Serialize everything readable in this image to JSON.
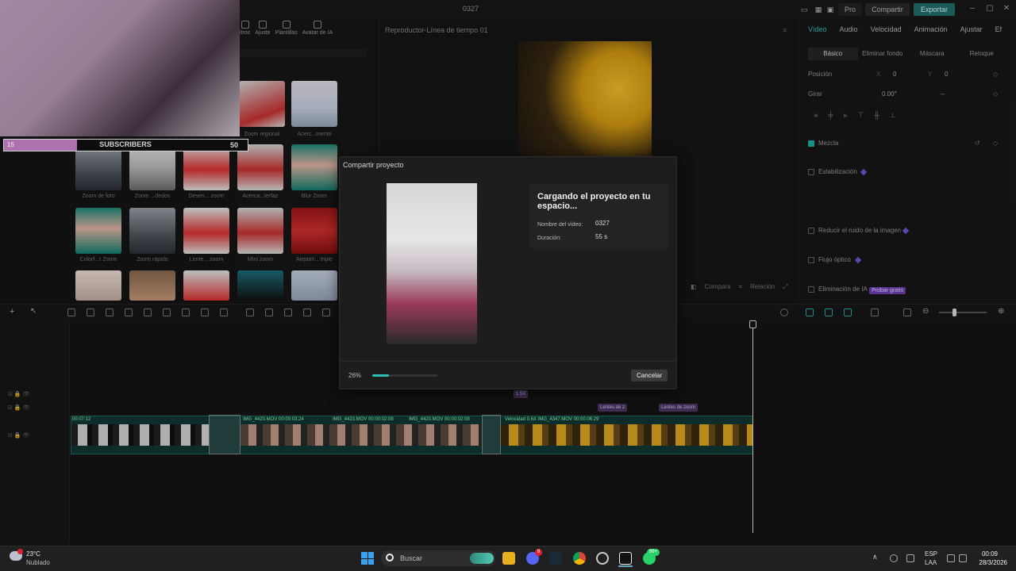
{
  "window": {
    "title": "0327",
    "pro_label": "Pro",
    "share_label": "Compartir",
    "export_label": "Exportar"
  },
  "media_tabs": [
    "itros",
    "Ajuste",
    "Plantillas",
    "Avatar de IA"
  ],
  "thumbnails": [
    {
      "label": "Zoom regional"
    },
    {
      "label": "Acerc...mente"
    },
    {
      "label": "Zoom de foto"
    },
    {
      "label": "Zoom ...dedos"
    },
    {
      "label": "Desen... zoom"
    },
    {
      "label": "Acerca...terfaz"
    },
    {
      "label": "Blur Zoom"
    },
    {
      "label": "Colorf...r Zoom"
    },
    {
      "label": "Zoom rápido"
    },
    {
      "label": "Lente... zoom"
    },
    {
      "label": "Mini zoom"
    },
    {
      "label": "Alejami... triple"
    }
  ],
  "overlay": {
    "left_count": "15",
    "label": "SUBSCRIBERS",
    "right_count": "50"
  },
  "player": {
    "title": "Reproductor-Línea de tiempo 01",
    "compare_label": "Compara",
    "ratio_label": "Relación"
  },
  "properties": {
    "tabs": [
      "Vídeo",
      "Audio",
      "Velocidad",
      "Animación",
      "Ajustar",
      "Ef"
    ],
    "subtabs": [
      "Básico",
      "Eliminar fondo",
      "Máscara",
      "Retoque"
    ],
    "position_label": "Posición",
    "x_label": "X",
    "x_value": "0",
    "y_label": "Y",
    "y_value": "0",
    "rotate_label": "Girar",
    "rotate_value": "0.00°",
    "rotate_dash": "–",
    "blend_label": "Mezcla",
    "stabilization_label": "Estabilización",
    "reduce_noise_label": "Reducir el ruido de la imagen",
    "optical_flow_label": "Flujo óptico",
    "ai_remove_label": "Eliminación de IA",
    "ai_badge": "Probar gratis"
  },
  "timeline": {
    "clip_labels": [
      "00:07:12",
      "IMG_4420.MOV  00:00:03:24",
      "IMG_4423.MOV  00:00:02:08",
      "IMG_4420.MOV  00:00:02:08",
      "Velocidad 0.6X   IMG_4347.MOV  00:00:06:29"
    ],
    "tags": [
      "Lentes de z",
      "Lentes de zoom"
    ],
    "speed_mark": "1.5X"
  },
  "modal": {
    "title": "Compartir proyecto",
    "heading": "Cargando el proyecto en tu espacio...",
    "name_label": "Nombre del vídeo:",
    "name_value": "0327",
    "duration_label": "Duración:",
    "duration_value": "55 s",
    "progress_text": "26%",
    "progress": 0.26,
    "cancel_label": "Cancelar"
  },
  "taskbar": {
    "temperature": "23°C",
    "weather": "Nublado",
    "search_placeholder": "Buscar",
    "lang_top": "ESP",
    "lang_bottom": "LAA",
    "time": "00:09",
    "date": "28/3/2026",
    "discord_badge": "9",
    "whatsapp_badge": "99+"
  },
  "colors": {
    "accent": "#2fbfb8",
    "export": "#1f6f6a",
    "subscribers_fill": "#d58ad6"
  }
}
